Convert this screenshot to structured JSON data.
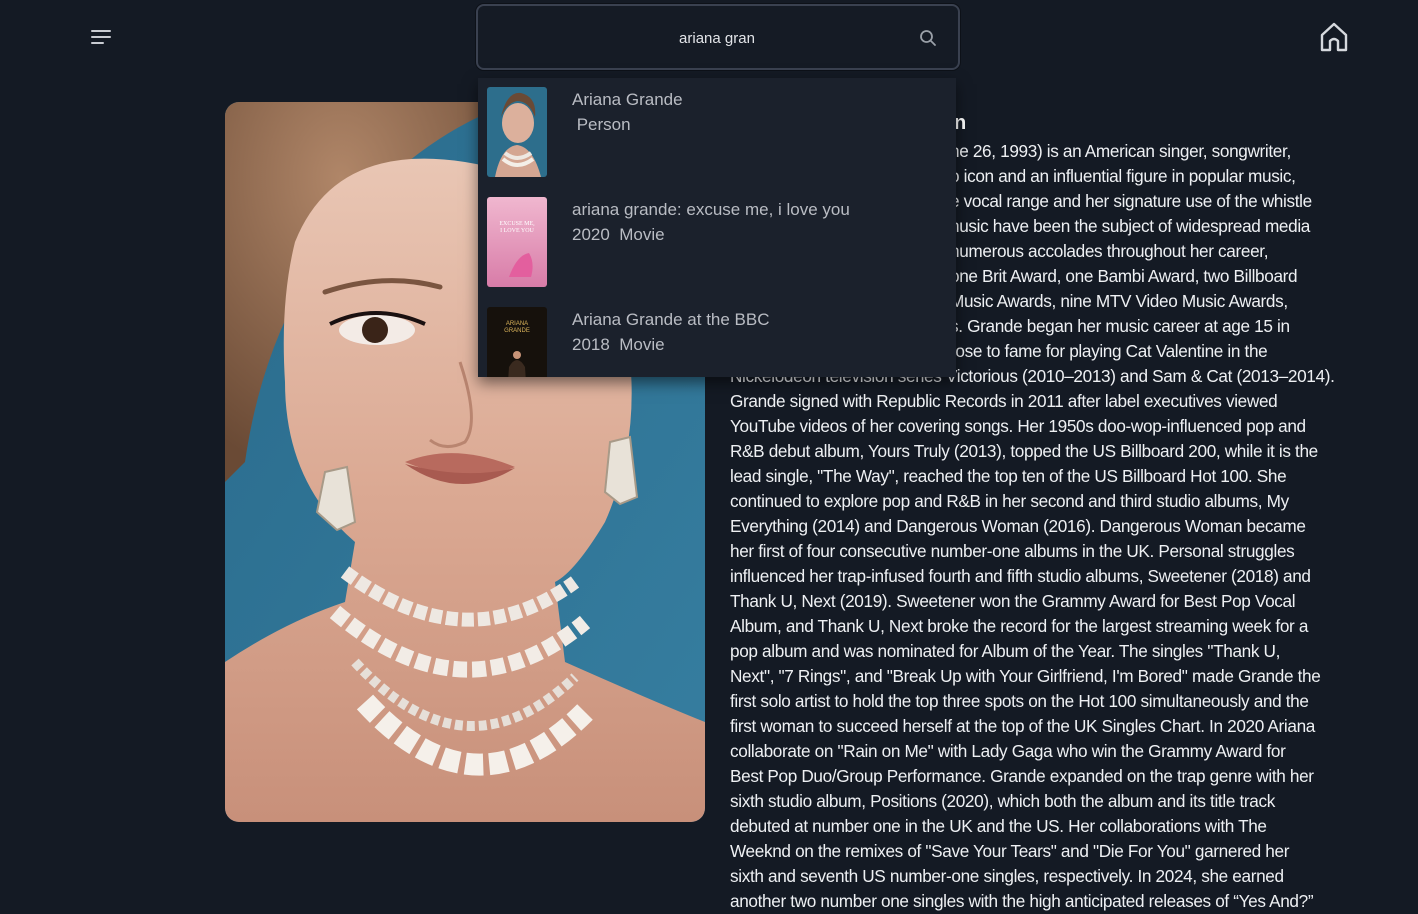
{
  "header": {
    "menu_icon": "hamburger-menu-icon",
    "home_icon": "home-icon"
  },
  "search": {
    "value": "ariana gran",
    "icon": "search-icon"
  },
  "results": [
    {
      "title": "Ariana Grande",
      "subtitle": " Person",
      "thumb_icon": "person-photo"
    },
    {
      "title": "ariana grande: excuse me, i love you",
      "subtitle": "2020  Movie",
      "thumb_icon": "movie-poster-pink"
    },
    {
      "title": "Ariana Grande at the BBC",
      "subtitle": "2018  Movie",
      "thumb_icon": "movie-poster-dark"
    }
  ],
  "poster_thumb_text": {
    "excuse_me": "EXCUSE ME,\nI LOVE YOU",
    "bbc": "ARIANA\nGRANDE"
  },
  "profile": {
    "heading_fragment": "n",
    "bio_lines": [
      "ne 26, 1993) is an American singer, songwriter,",
      "o icon and an influential figure in popular music,",
      "e vocal range and her signature use of the whistle",
      "nusic have been the subject of widespread media",
      " numerous accolades throughout her career,",
      " one Brit Award, one Bambi Award, two Billboard",
      " Music Awards, nine MTV Video Music Awards,",
      "s. Grande began her music career at age 15 in",
      " rose to fame for playing Cat Valentine in the",
      "Nickelodeon television series Victorious (2010–2013) and Sam & Cat (2013–2014).",
      "Grande signed with Republic Records in 2011 after label executives viewed",
      "YouTube videos of her covering songs. Her 1950s doo-wop-influenced pop and",
      "R&B debut album, Yours Truly (2013), topped the US Billboard 200, while it is the",
      "lead single, \"The Way\", reached the top ten of the US Billboard Hot 100. She",
      "continued to explore pop and R&B in her second and third studio albums, My",
      "Everything (2014) and Dangerous Woman (2016). Dangerous Woman became",
      "her first of four consecutive number-one albums in the UK. Personal struggles",
      "influenced her trap-infused fourth and fifth studio albums, Sweetener (2018) and",
      "Thank U, Next (2019). Sweetener won the Grammy Award for Best Pop Vocal",
      "Album, and Thank U, Next broke the record for the largest streaming week for a",
      "pop album and was nominated for Album of the Year. The singles \"Thank U,",
      "Next\", \"7 Rings\", and \"Break Up with Your Girlfriend, I'm Bored\" made Grande the",
      "first solo artist to hold the top three spots on the Hot 100 simultaneously and the",
      "first woman to succeed herself at the top of the UK Singles Chart. In 2020 Ariana",
      "collaborate on \"Rain on Me\" with Lady Gaga who win the Grammy Award for",
      "Best Pop Duo/Group Performance. Grande expanded on the trap genre with her",
      "sixth studio album, Positions (2020), which both the album and its title track",
      "debuted at number one in the UK and the US. Her collaborations with The",
      "Weeknd on the remixes of \"Save Your Tears\" and \"Die For You\" garnered her",
      "sixth and seventh US number-one singles, respectively. In 2024, she earned",
      "another two number one singles with the high anticipated releases of “Yes And?”"
    ],
    "bio_offsets": [
      220,
      220,
      220,
      220,
      220,
      220,
      220,
      220,
      220,
      0,
      0,
      0,
      0,
      0,
      0,
      0,
      0,
      0,
      0,
      0,
      0,
      0,
      0,
      0,
      0,
      0,
      0,
      0,
      0,
      0,
      0
    ]
  },
  "colors": {
    "background": "#141a24",
    "dropdown": "#1b212c",
    "text": "#eef0f3",
    "muted_text": "#b9bcc3",
    "portrait_bg": "#2e6f8f"
  }
}
